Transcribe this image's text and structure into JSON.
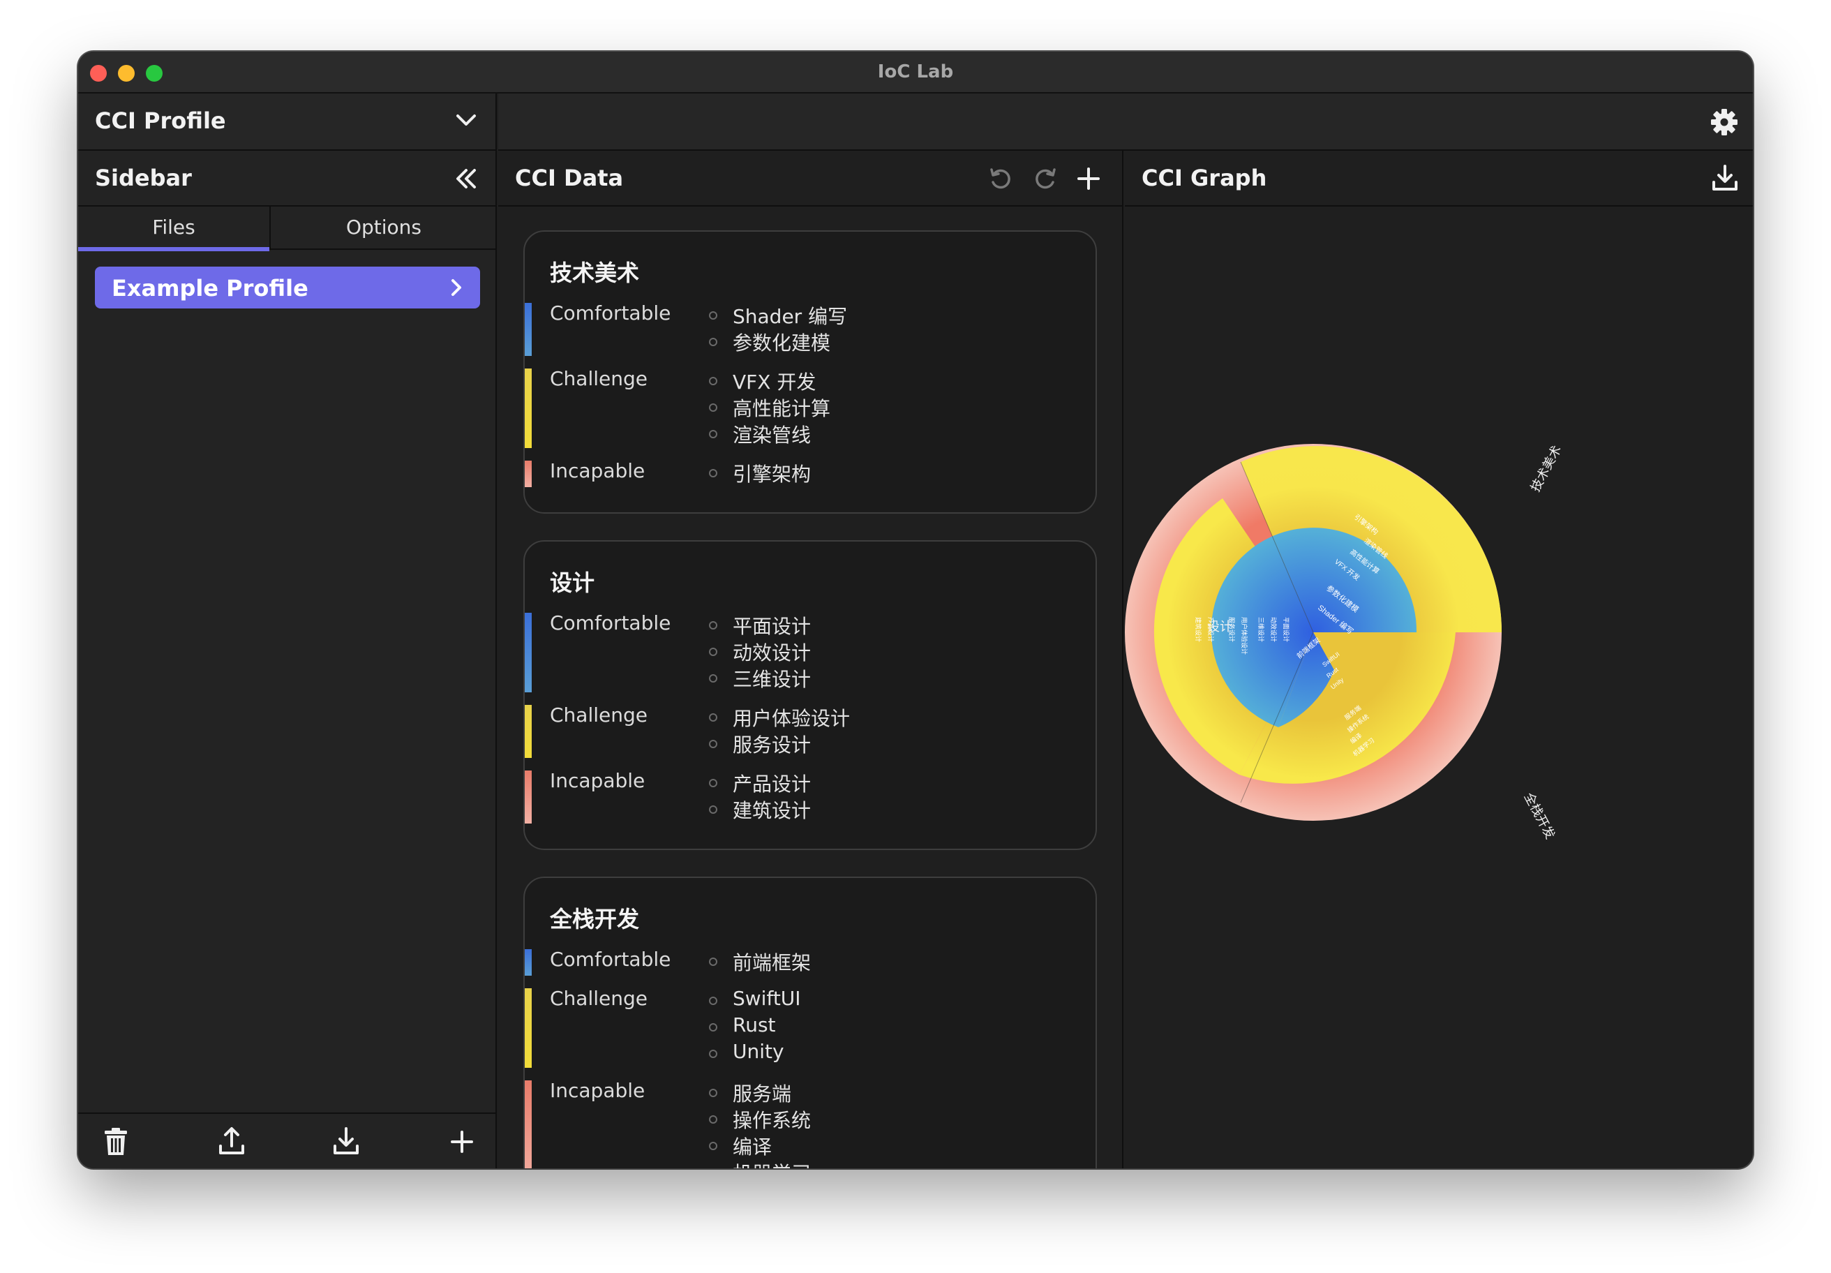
{
  "window": {
    "title": "IoC Lab"
  },
  "profile_bar": {
    "label": "CCI Profile"
  },
  "sidebar": {
    "title": "Sidebar",
    "tabs": [
      "Files",
      "Options"
    ],
    "files": [
      {
        "label": "Example Profile"
      }
    ]
  },
  "cci_data": {
    "title": "CCI Data",
    "levels": [
      "Comfortable",
      "Challenge",
      "Incapable"
    ],
    "categories": [
      {
        "name": "技术美术",
        "comfortable": [
          "Shader 编写",
          "参数化建模"
        ],
        "challenge": [
          "VFX 开发",
          "高性能计算",
          "渲染管线"
        ],
        "incapable": [
          "引擎架构"
        ]
      },
      {
        "name": "设计",
        "comfortable": [
          "平面设计",
          "动效设计",
          "三维设计"
        ],
        "challenge": [
          "用户体验设计",
          "服务设计"
        ],
        "incapable": [
          "产品设计",
          "建筑设计"
        ]
      },
      {
        "name": "全栈开发",
        "comfortable": [
          "前端框架"
        ],
        "challenge": [
          "SwiftUI",
          "Rust",
          "Unity"
        ],
        "incapable": [
          "服务端",
          "操作系统",
          "编译",
          "机器学习"
        ]
      }
    ]
  },
  "cci_graph": {
    "title": "CCI Graph",
    "labels": {
      "cat_a": "技术美术",
      "cat_b": "设计",
      "cat_c": "全栈开发"
    }
  },
  "colors": {
    "accent": "#6e6ae8",
    "comfortable": "#3b7bd8",
    "challenge": "#f0d83a",
    "incapable": "#ec8a78"
  },
  "icons": {
    "profile_dropdown": "chevron-down-icon",
    "collapse_sidebar": "double-chevron-left-icon",
    "settings": "gear-icon",
    "undo": "undo-icon",
    "redo": "redo-icon",
    "add": "plus-icon",
    "download": "download-icon",
    "delete": "trash-icon",
    "upload": "upload-icon"
  }
}
